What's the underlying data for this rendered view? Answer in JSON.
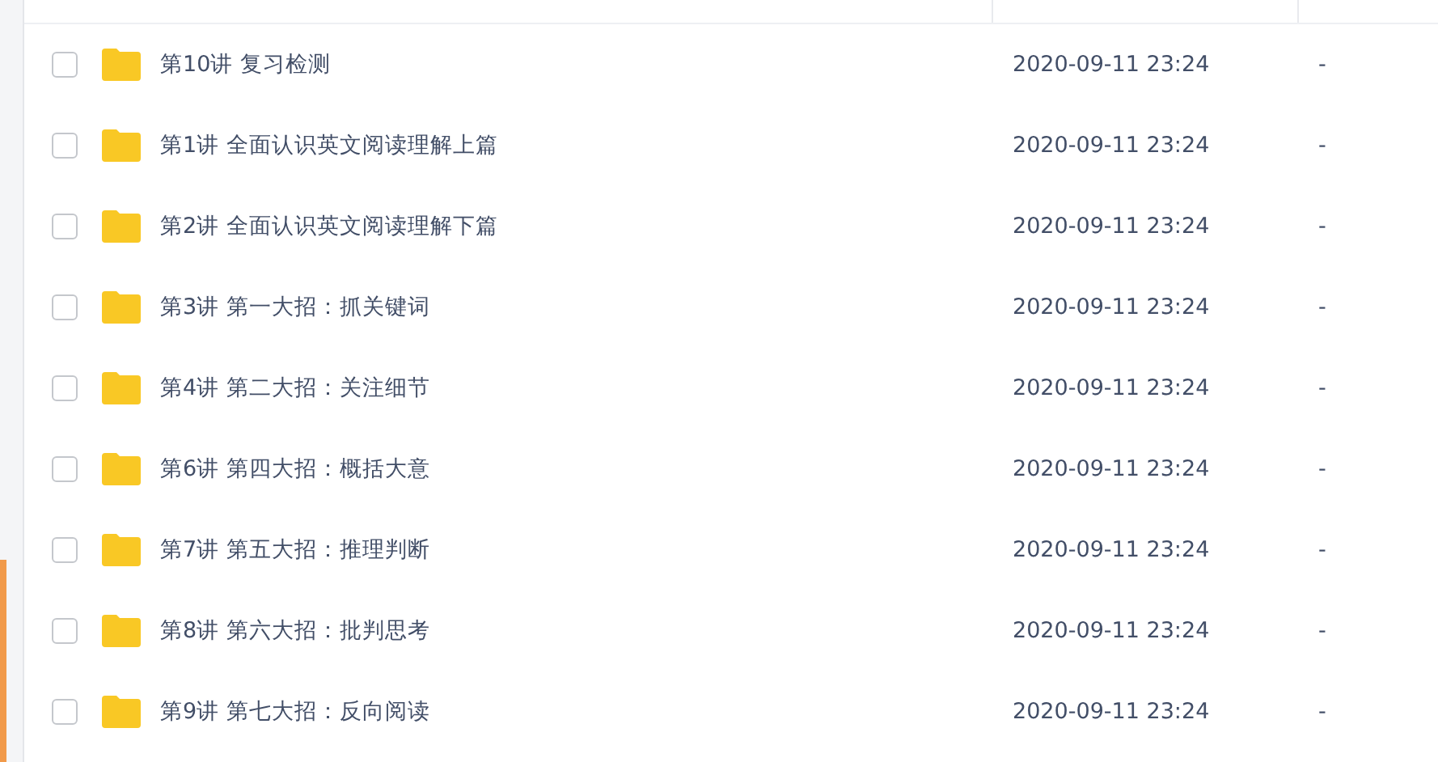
{
  "files": [
    {
      "name": "第10讲 复习检测",
      "modified": "2020-09-11 23:24",
      "size": "-",
      "checked": false
    },
    {
      "name": "第1讲 全面认识英文阅读理解上篇",
      "modified": "2020-09-11 23:24",
      "size": "-",
      "checked": false
    },
    {
      "name": "第2讲 全面认识英文阅读理解下篇",
      "modified": "2020-09-11 23:24",
      "size": "-",
      "checked": false
    },
    {
      "name": "第3讲 第一大招：抓关键词",
      "modified": "2020-09-11 23:24",
      "size": "-",
      "checked": false
    },
    {
      "name": "第4讲 第二大招：关注细节",
      "modified": "2020-09-11 23:24",
      "size": "-",
      "checked": false
    },
    {
      "name": "第6讲 第四大招：概括大意",
      "modified": "2020-09-11 23:24",
      "size": "-",
      "checked": false
    },
    {
      "name": "第7讲 第五大招：推理判断",
      "modified": "2020-09-11 23:24",
      "size": "-",
      "checked": false
    },
    {
      "name": "第8讲 第六大招：批判思考",
      "modified": "2020-09-11 23:24",
      "size": "-",
      "checked": false
    },
    {
      "name": "第9讲 第七大招：反向阅读",
      "modified": "2020-09-11 23:24",
      "size": "-",
      "checked": false
    }
  ]
}
